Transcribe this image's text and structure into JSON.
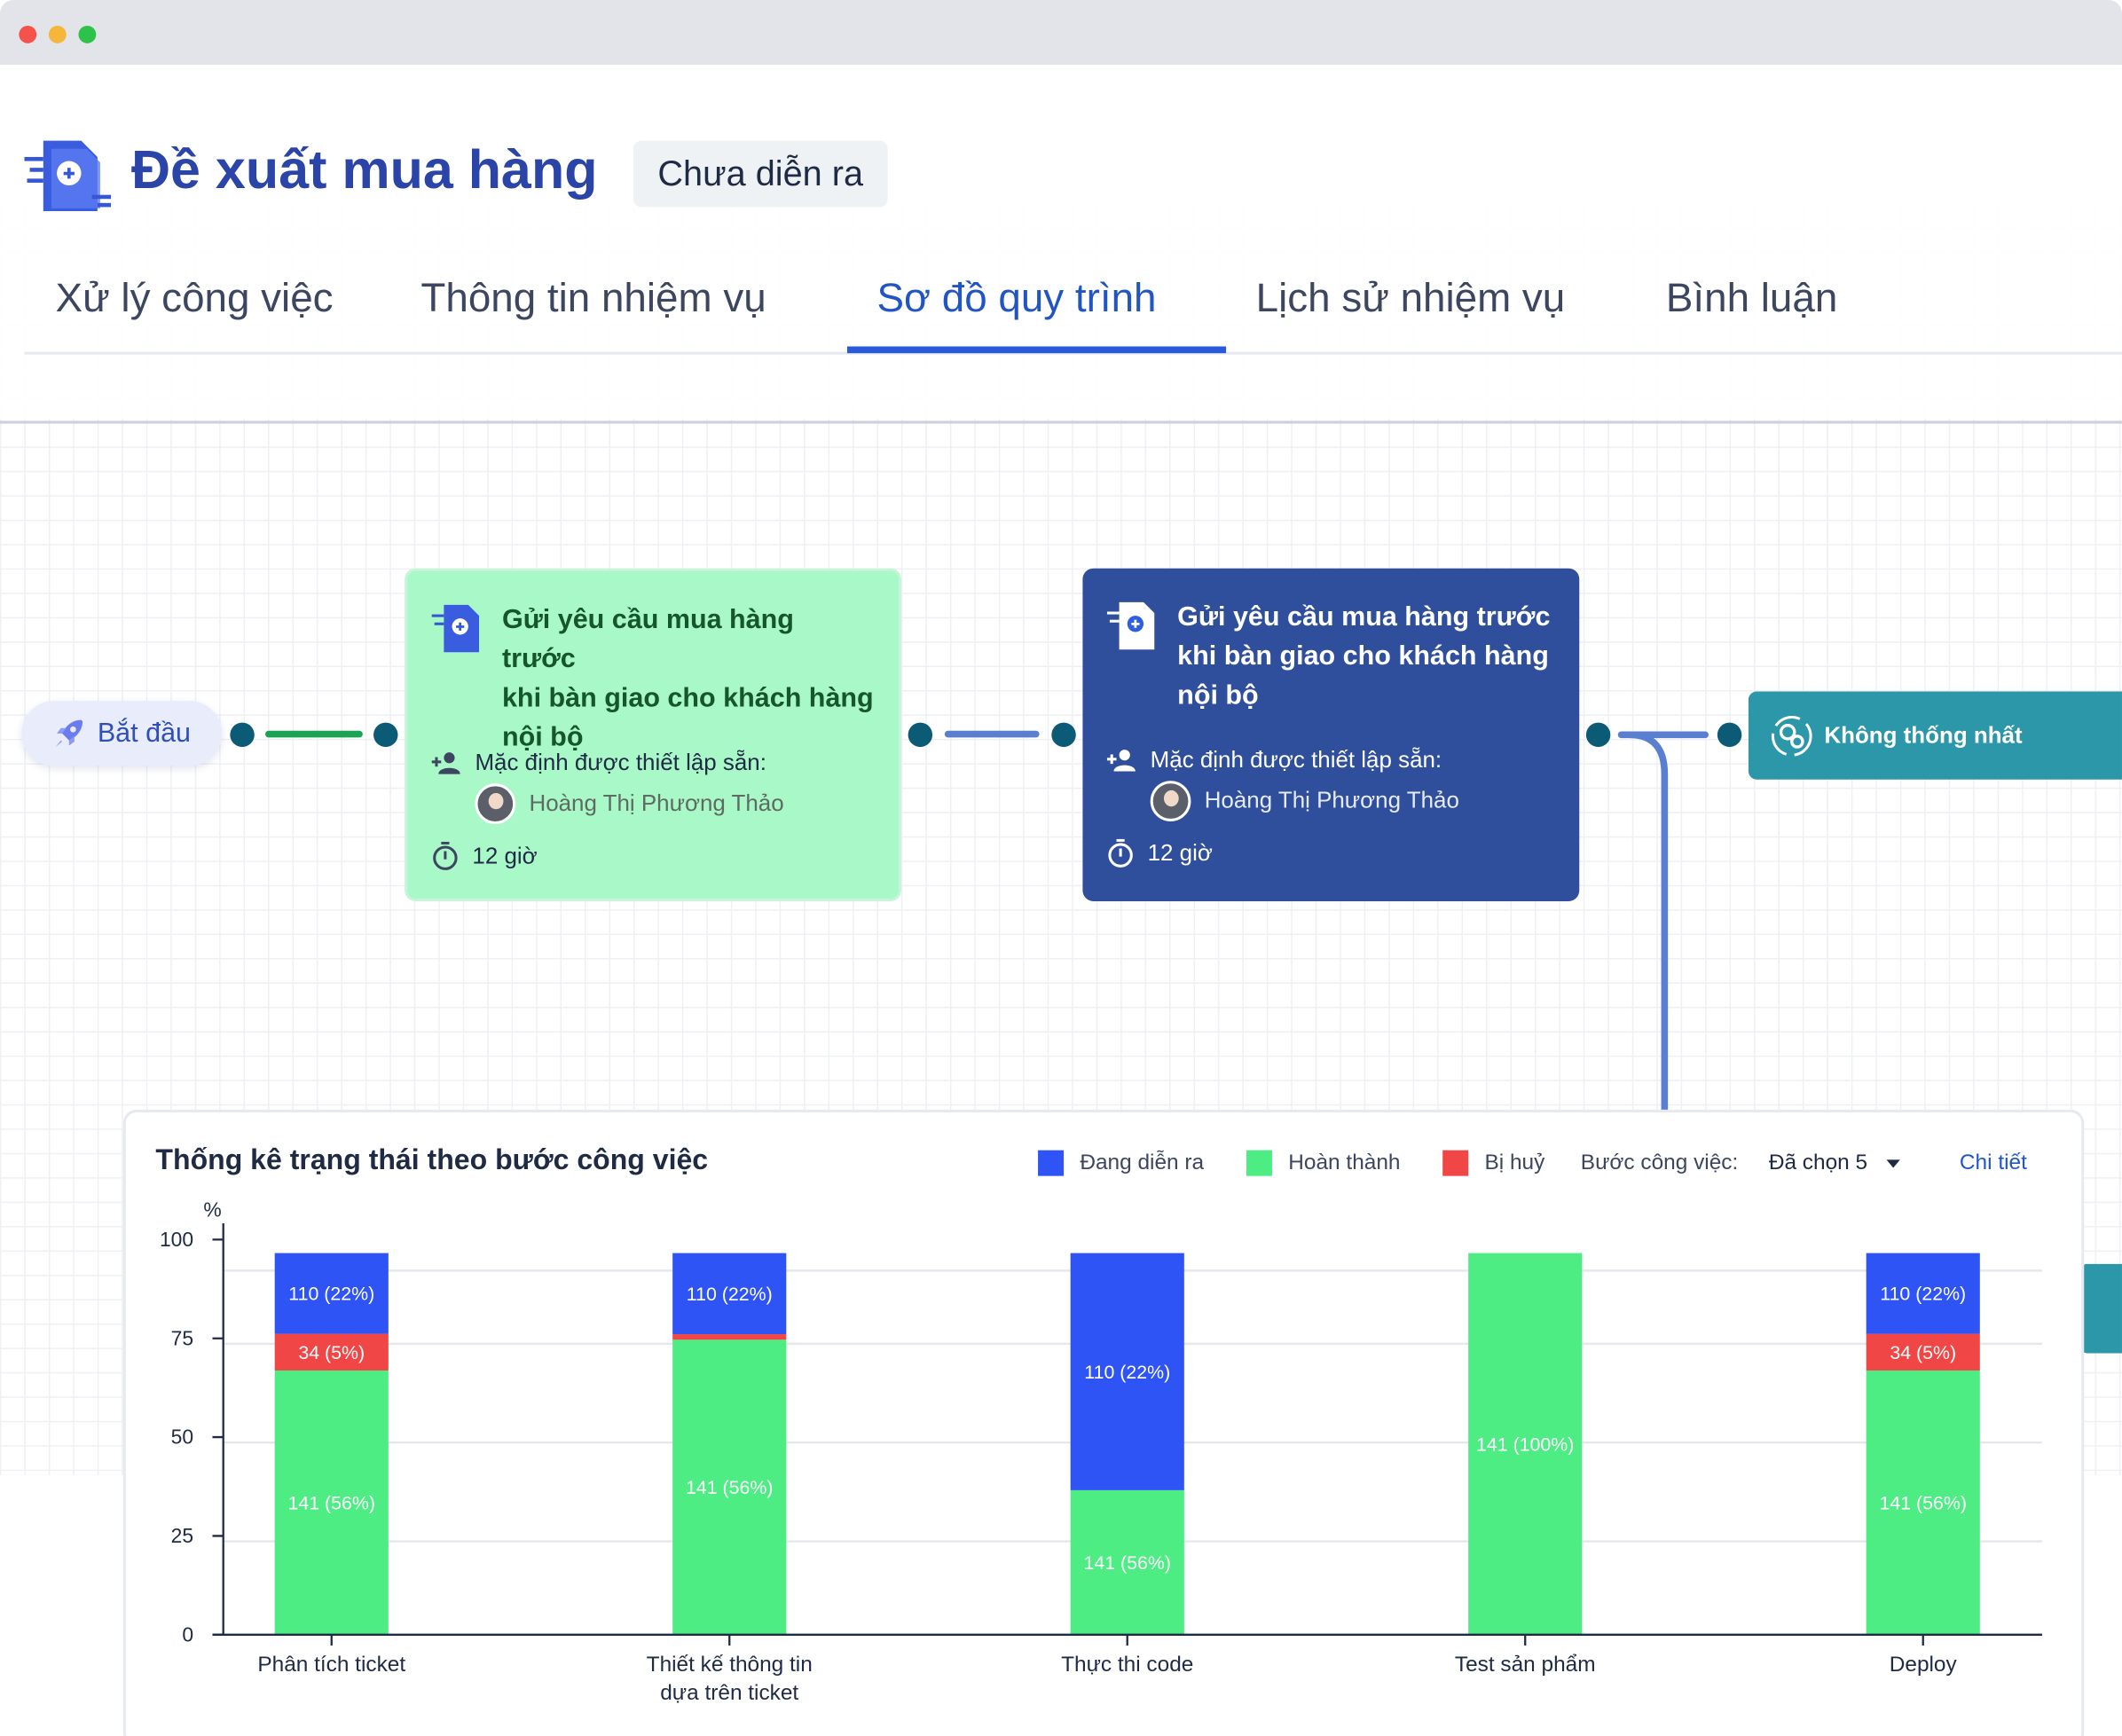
{
  "header": {
    "title": "Đề xuất mua hàng",
    "status": "Chưa diễn ra"
  },
  "tabs": [
    {
      "label": "Xử lý công việc",
      "active": false
    },
    {
      "label": "Thông tin nhiệm vụ",
      "active": false
    },
    {
      "label": "Sơ đồ quy trình",
      "active": true
    },
    {
      "label": "Lịch sử nhiệm vụ",
      "active": false
    },
    {
      "label": "Bình luận",
      "active": false
    }
  ],
  "flow": {
    "start": {
      "label": "Bắt đầu",
      "icon": "rocket-icon"
    },
    "nodes": [
      {
        "title_lines": [
          "Gửi yêu cầu mua hàng trước",
          "khi bàn giao cho khách hàng",
          "nội bộ"
        ],
        "assign_label": "Mặc định được thiết lập sẵn:",
        "assignee": "Hoàng Thị Phương Thảo",
        "duration": "12 giờ",
        "state": "completed",
        "color": "#a9f8c8"
      },
      {
        "title_lines": [
          "Gửi yêu cầu mua hàng trước",
          "khi bàn giao cho khách hàng",
          "nội bộ"
        ],
        "assign_label": "Mặc định được thiết lập sẵn:",
        "assignee": "Hoàng Thị Phương Thảo",
        "duration": "12 giờ",
        "state": "current",
        "color": "#2f4f9d"
      }
    ],
    "branch": {
      "label": "Không thống nhất",
      "icon": "gears-icon",
      "color": "#2c97a8"
    }
  },
  "stats": {
    "title": "Thống kê trạng thái theo bước công việc",
    "legend": [
      {
        "label": "Đang diễn ra",
        "color": "#2f54f5"
      },
      {
        "label": "Hoàn thành",
        "color": "#4ded84"
      },
      {
        "label": "Bị huỷ",
        "color": "#f14646"
      }
    ],
    "filter_label": "Bước công việc:",
    "filter_value": "Đã chọn 5",
    "detail_link": "Chi tiết"
  },
  "chart_data": {
    "type": "bar",
    "stacked": true,
    "ylabel": "%",
    "ylim": [
      0,
      100
    ],
    "yticks": [
      0,
      25,
      50,
      75,
      100
    ],
    "categories": [
      [
        "Phân tích ticket"
      ],
      [
        "Thiết kế thông tin",
        "dựa trên ticket"
      ],
      [
        "Thực thi code"
      ],
      [
        "Test sản phẩm"
      ],
      [
        "Deploy"
      ]
    ],
    "series": [
      {
        "name": "Hoàn thành",
        "color": "#4ded84",
        "values": [
          72,
          80,
          39,
          100,
          72
        ],
        "labels": [
          "141 (56%)",
          "141 (56%)",
          "141 (56%)",
          "141 (100%)",
          "141 (56%)"
        ]
      },
      {
        "name": "Bị huỷ",
        "color": "#f14646",
        "values": [
          10,
          1.5,
          0,
          0,
          10
        ],
        "labels": [
          "34 (5%)",
          "",
          "",
          "",
          "34 (5%)"
        ]
      },
      {
        "name": "Đang diễn ra",
        "color": "#2f54f5",
        "values": [
          22,
          22,
          64,
          0,
          22
        ],
        "labels": [
          "110 (22%)",
          "110 (22%)",
          "110 (22%)",
          "",
          "110 (22%)"
        ]
      }
    ]
  }
}
